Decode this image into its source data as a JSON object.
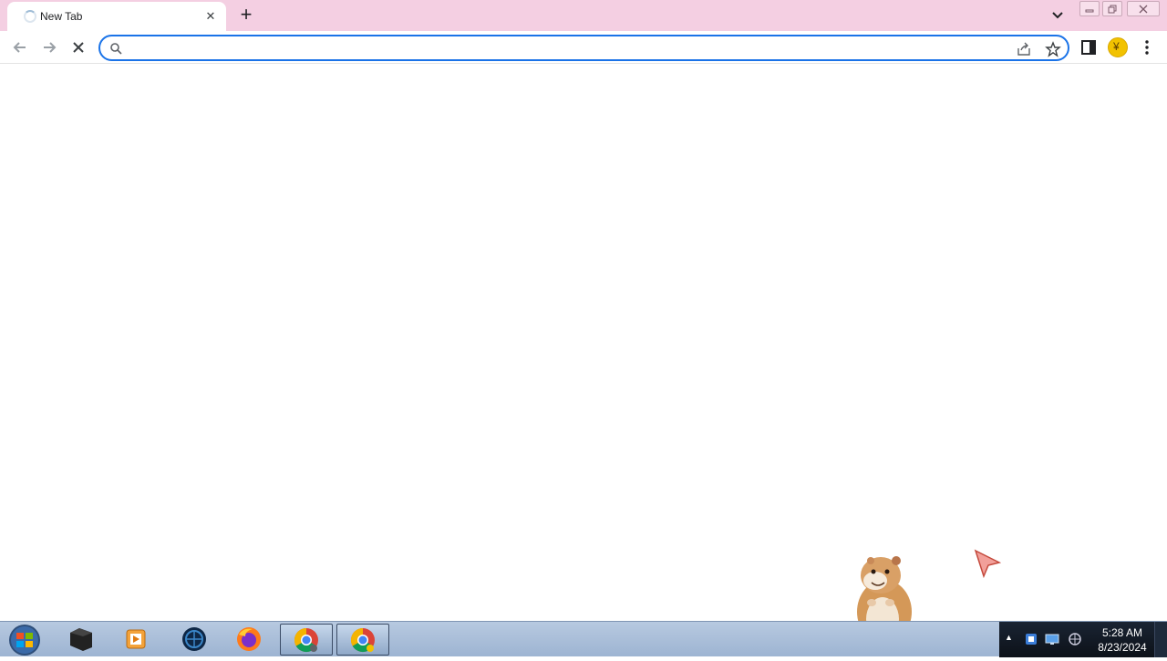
{
  "browser": {
    "tab": {
      "title": "New Tab",
      "loading": true
    },
    "new_tab_symbol": "+",
    "close_tab_symbol": "✕"
  },
  "toolbar": {
    "back_icon": "arrow-left-icon",
    "forward_icon": "arrow-right-icon",
    "stop_icon": "close-icon",
    "omnibox": {
      "value": "",
      "placeholder": ""
    },
    "avatar_initial": "¥"
  },
  "taskbar": {
    "apps": [
      "start-orb",
      "terminal",
      "media-player",
      "browser-globe",
      "firefox",
      "chrome",
      "chrome"
    ],
    "clock": {
      "time": "5:28 AM",
      "date": "8/23/2024"
    }
  },
  "colors": {
    "tabstrip": "#f4cfe2",
    "omnibox_focus": "#1a73e8",
    "taskbar": "#9db4d2"
  }
}
